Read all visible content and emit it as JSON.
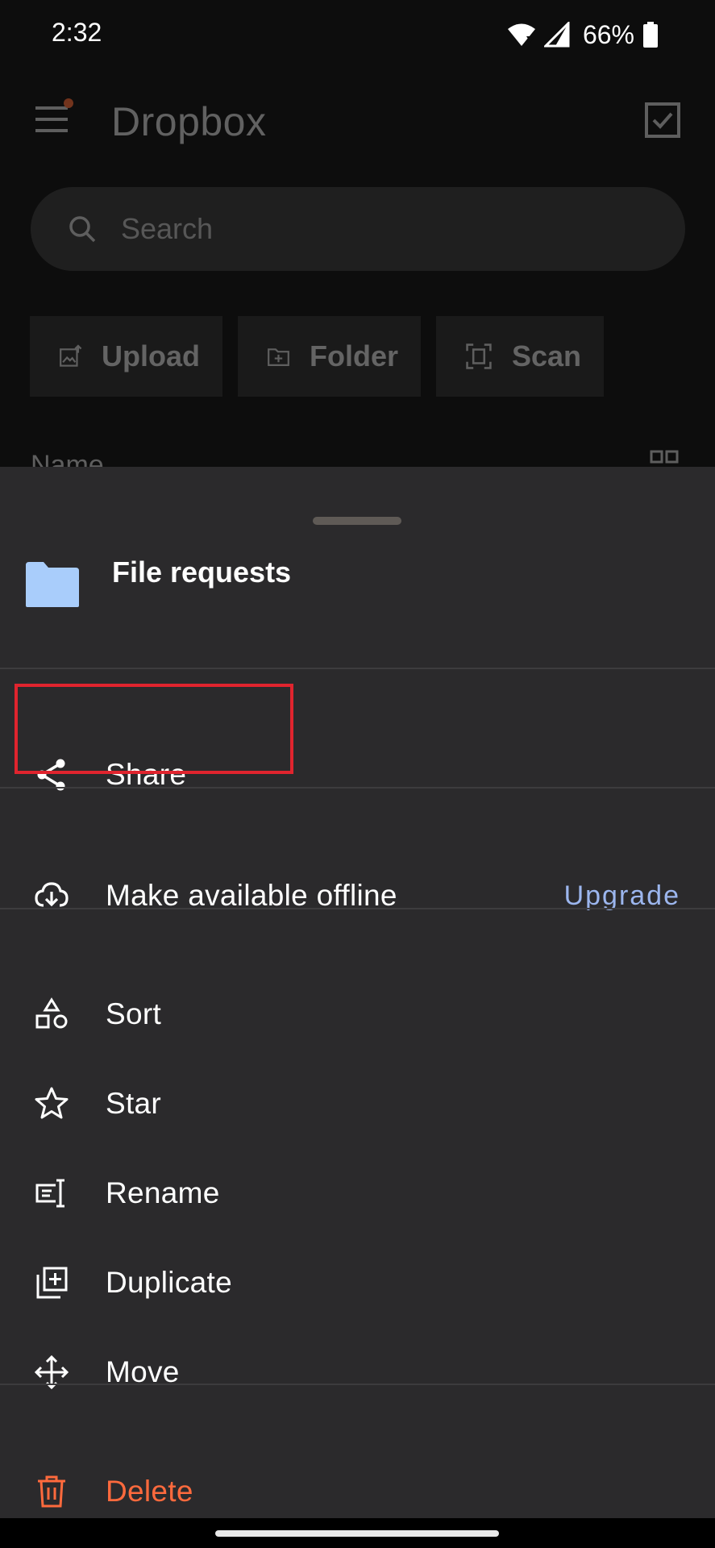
{
  "status_bar": {
    "time": "2:32",
    "battery": "66%"
  },
  "background_app": {
    "title": "Dropbox",
    "search_placeholder": "Search",
    "actions": [
      {
        "label": "Upload",
        "icon": "upload-image-icon"
      },
      {
        "label": "Folder",
        "icon": "new-folder-icon"
      },
      {
        "label": "Scan",
        "icon": "scan-icon"
      }
    ],
    "sort_label": "Name"
  },
  "sheet": {
    "title": "File requests",
    "items": [
      {
        "label": "Share",
        "icon": "share-icon"
      },
      {
        "label": "Make available offline",
        "icon": "offline-download-icon",
        "right_label": "Upgrade"
      },
      {
        "label": "Sort",
        "icon": "sort-shapes-icon"
      },
      {
        "label": "Star",
        "icon": "star-icon"
      },
      {
        "label": "Rename",
        "icon": "rename-icon"
      },
      {
        "label": "Duplicate",
        "icon": "duplicate-icon"
      },
      {
        "label": "Move",
        "icon": "move-icon"
      },
      {
        "label": "Delete",
        "icon": "trash-icon"
      }
    ]
  },
  "colors": {
    "sheet_background": "#2b2a2c",
    "accent_link": "#9cb6ee",
    "danger": "#ff6a3d",
    "highlight": "#e0242e",
    "folder": "#a9cdfb"
  }
}
